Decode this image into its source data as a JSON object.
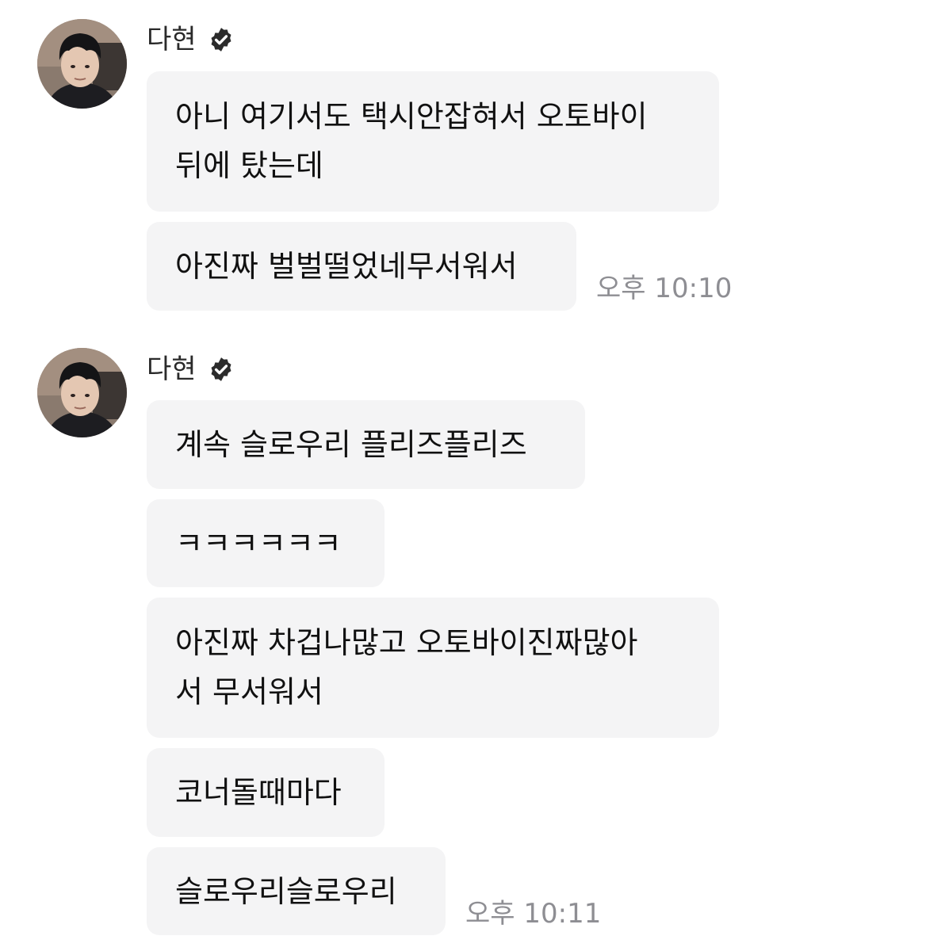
{
  "colors": {
    "bubble_bg": "#f4f4f5",
    "timestamp": "#8e8e93",
    "text": "#111111",
    "verified_badge": "#2b2b2b"
  },
  "conversation": {
    "groups": [
      {
        "sender": {
          "name": "다현",
          "verified_icon": "verified-badge-icon",
          "avatar_icon": "profile-avatar"
        },
        "messages": [
          {
            "text": "아니 여기서도 택시안잡혀서 오토바이\n뒤에 탔는데"
          },
          {
            "text": "아진짜 벌벌떨었네무서워서"
          }
        ],
        "time": "오후 10:10"
      },
      {
        "sender": {
          "name": "다현",
          "verified_icon": "verified-badge-icon",
          "avatar_icon": "profile-avatar"
        },
        "messages": [
          {
            "text": "계속 슬로우리 플리즈플리즈"
          },
          {
            "text": "ㅋㅋㅋㅋㅋㅋ"
          },
          {
            "text": "아진짜 차겁나많고 오토바이진짜많아\n서 무서워서"
          },
          {
            "text": "코너돌때마다"
          },
          {
            "text": "슬로우리슬로우리"
          }
        ],
        "time": "오후 10:11"
      }
    ]
  }
}
